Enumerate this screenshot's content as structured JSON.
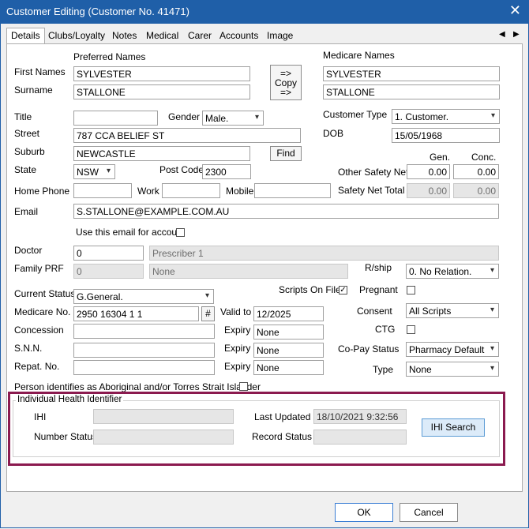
{
  "window": {
    "title": "Customer Editing (Customer No. 41471)",
    "close": "✕"
  },
  "tabs": [
    "Details",
    "Clubs/Loyalty",
    "Notes",
    "Medical",
    "Carer",
    "Accounts",
    "Image"
  ],
  "tab_nav": {
    "prev": "◀",
    "next": "▶"
  },
  "names": {
    "preferred_header": "Preferred Names",
    "medicare_header": "Medicare Names",
    "first_label": "First Names",
    "surname_label": "Surname",
    "pref_first": "SYLVESTER",
    "pref_surname": "STALLONE",
    "med_first": "SYLVESTER",
    "med_surname": "STALLONE",
    "copy_top": "=>",
    "copy_mid": "Copy",
    "copy_bot": "=>"
  },
  "personal": {
    "title_label": "Title",
    "title_value": "",
    "gender_label": "Gender",
    "gender_value": "Male.",
    "street_label": "Street",
    "street_value": "787 CCA BELIEF ST",
    "suburb_label": "Suburb",
    "suburb_value": "NEWCASTLE",
    "find_label": "Find",
    "state_label": "State",
    "state_value": "NSW",
    "postcode_label": "Post Code",
    "postcode_value": "2300",
    "homephone_label": "Home Phone",
    "work_label": "Work",
    "mobile_label": "Mobile",
    "email_label": "Email",
    "email_value": "S.STALLONE@EXAMPLE.COM.AU",
    "use_email_label": "Use this email for account"
  },
  "customer": {
    "type_label": "Customer Type",
    "type_value": "1. Customer.",
    "dob_label": "DOB",
    "dob_value": "15/05/1968",
    "gen_header": "Gen.",
    "conc_header": "Conc.",
    "other_sn_label": "Other Safety Net",
    "other_gen": "0.00",
    "other_conc": "0.00",
    "sn_total_label": "Safety Net Total",
    "total_gen": "0.00",
    "total_conc": "0.00"
  },
  "doctor": {
    "doctor_label": "Doctor",
    "doctor_value": "0",
    "prescriber_value": "Prescriber 1",
    "family_label": "Family PRF",
    "family_value": "0",
    "family_name": "None",
    "rship_label": "R/ship",
    "rship_value": "0. No Relation."
  },
  "medicare": {
    "status_label": "Current Status",
    "status_value": "G.General.",
    "medicare_label": "Medicare No.",
    "medicare_value": "2950 16304 1 1",
    "hash": "#",
    "valid_label": "Valid to",
    "valid_value": "12/2025",
    "concession_label": "Concession",
    "expiry_label": "Expiry",
    "conc_expiry": "None",
    "snn_label": "S.N.N.",
    "snn_expiry": "None",
    "repat_label": "Repat. No.",
    "repat_expiry": "None",
    "scripts_label": "Scripts On File",
    "pregnant_label": "Pregnant",
    "consent_label": "Consent",
    "consent_value": "All Scripts",
    "ctg_label": "CTG",
    "copay_label": "Co-Pay Status",
    "copay_value": "Pharmacy Default",
    "type_label": "Type",
    "type_value": "None",
    "aboriginal_label": "Person identifies as Aboriginal and/or Torres Strait Islander"
  },
  "ihi": {
    "group_label": "Individual Health Identifier",
    "ihi_label": "IHI",
    "number_status_label": "Number Status",
    "last_updated_label": "Last Updated",
    "last_updated_value": "18/10/2021  9:32:56",
    "record_status_label": "Record Status",
    "search_label": "IHI Search"
  },
  "footer": {
    "ok": "OK",
    "cancel": "Cancel"
  },
  "colors": {
    "title_bar": "#1f5fa8",
    "highlight": "#8b1a4f"
  }
}
